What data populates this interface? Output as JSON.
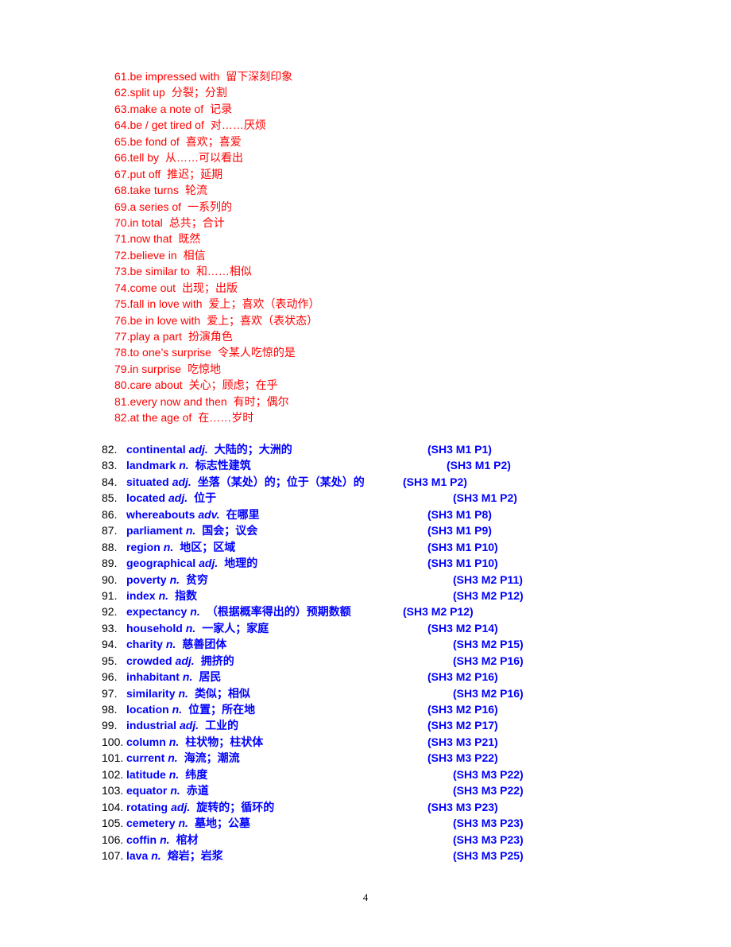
{
  "colors": {
    "phrase": "#ff0000",
    "vocab": "#0000ff",
    "number": "#000000"
  },
  "phrases": [
    {
      "n": "61.",
      "en": "be impressed with",
      "zh": "留下深刻印象"
    },
    {
      "n": "62.",
      "en": "split up",
      "zh": "分裂；分割"
    },
    {
      "n": "63.",
      "en": "make a note of",
      "zh": "记录"
    },
    {
      "n": "64.",
      "en": "be / get tired of",
      "zh": "对……厌烦"
    },
    {
      "n": "65.",
      "en": "be fond of",
      "zh": "喜欢；喜爱"
    },
    {
      "n": "66.",
      "en": "tell by",
      "zh": "从……可以看出"
    },
    {
      "n": "67.",
      "en": "put off",
      "zh": "推迟；延期"
    },
    {
      "n": "68.",
      "en": "take turns",
      "zh": "轮流"
    },
    {
      "n": "69.",
      "en": "a series of",
      "zh": "一系列的"
    },
    {
      "n": "70.",
      "en": "in total",
      "zh": "总共；合计"
    },
    {
      "n": "71.",
      "en": "now that",
      "zh": "既然"
    },
    {
      "n": "72.",
      "en": "believe in",
      "zh": "相信"
    },
    {
      "n": "73.",
      "en": "be similar to",
      "zh": "和……相似"
    },
    {
      "n": "74.",
      "en": "come out",
      "zh": "出现；出版"
    },
    {
      "n": "75.",
      "en": "fall in love with",
      "zh": "爱上；喜欢（表动作）"
    },
    {
      "n": "76.",
      "en": "be in love with",
      "zh": "爱上；喜欢（表状态）"
    },
    {
      "n": "77.",
      "en": "play a part",
      "zh": "扮演角色"
    },
    {
      "n": "78.",
      "en": "to one’s surprise",
      "zh": "令某人吃惊的是"
    },
    {
      "n": "79.",
      "en": "in surprise",
      "zh": "吃惊地"
    },
    {
      "n": "80.",
      "en": "care about",
      "zh": "关心；顾虑；在乎"
    },
    {
      "n": "81.",
      "en": "every now and then",
      "zh": "有时；偶尔"
    },
    {
      "n": "82.",
      "en": "at the age of",
      "zh": "在……岁时"
    }
  ],
  "vocab": [
    {
      "n": "82.",
      "word": "continental",
      "pos": "adj.",
      "zh": "大陆的；大洲的",
      "ref": "(SH3 M1 P1)",
      "col": "b"
    },
    {
      "n": "83.",
      "word": "landmark",
      "pos": "n.",
      "zh": "标志性建筑",
      "ref": "(SH3 M1 P2)",
      "col": "c"
    },
    {
      "n": "84.",
      "word": "situated",
      "pos": "adj.",
      "zh": "坐落（某处）的；位于（某处）的",
      "ref": "(SH3 M1 P2)",
      "col": "a"
    },
    {
      "n": "85.",
      "word": "located",
      "pos": "adj.",
      "zh": "位于",
      "ref": "(SH3 M1 P2)",
      "col": "d"
    },
    {
      "n": "86.",
      "word": "whereabouts",
      "pos": "adv.",
      "zh": "在哪里",
      "ref": "(SH3 M1 P8)",
      "col": "b"
    },
    {
      "n": "87.",
      "word": "parliament",
      "pos": "n.",
      "zh": "国会；议会",
      "ref": "(SH3 M1 P9)",
      "col": "b"
    },
    {
      "n": "88.",
      "word": "region",
      "pos": "n.",
      "zh": "地区；区域",
      "ref": "(SH3 M1 P10)",
      "col": "b"
    },
    {
      "n": "89.",
      "word": "geographical",
      "pos": "adj.",
      "zh": "地理的",
      "ref": "(SH3 M1 P10)",
      "col": "b"
    },
    {
      "n": "90.",
      "word": "poverty",
      "pos": "n.",
      "zh": "贫穷",
      "ref": "(SH3 M2 P11)",
      "col": "d"
    },
    {
      "n": "91.",
      "word": "index",
      "pos": "n.",
      "zh": "指数",
      "ref": "(SH3 M2 P12)",
      "col": "d"
    },
    {
      "n": "92.",
      "word": "expectancy",
      "pos": "n.",
      "zh": "（根据概率得出的）预期数额",
      "ref": "(SH3 M2 P12)",
      "col": "a"
    },
    {
      "n": "93.",
      "word": "household",
      "pos": "n.",
      "zh": "一家人；家庭",
      "ref": "(SH3 M2 P14)",
      "col": "b"
    },
    {
      "n": "94.",
      "word": "charity",
      "pos": "n.",
      "zh": "慈善团体",
      "ref": "(SH3 M2 P15)",
      "col": "d"
    },
    {
      "n": "95.",
      "word": "crowded",
      "pos": "adj.",
      "zh": "拥挤的",
      "ref": "(SH3 M2 P16)",
      "col": "d"
    },
    {
      "n": "96.",
      "word": "inhabitant",
      "pos": "n.",
      "zh": "居民",
      "ref": "(SH3 M2 P16)",
      "col": "b"
    },
    {
      "n": "97.",
      "word": "similarity",
      "pos": "n.",
      "zh": "类似；相似",
      "ref": "(SH3 M2 P16)",
      "col": "d"
    },
    {
      "n": "98.",
      "word": "location",
      "pos": "n.",
      "zh": "位置；所在地",
      "ref": "(SH3 M2 P16)",
      "col": "b"
    },
    {
      "n": "99.",
      "word": "industrial",
      "pos": "adj.",
      "zh": "工业的",
      "ref": "(SH3 M2 P17)",
      "col": "b"
    },
    {
      "n": "100.",
      "word": "column",
      "pos": "n.",
      "zh": "柱状物；柱状体",
      "ref": "(SH3 M3 P21)",
      "col": "b"
    },
    {
      "n": "101.",
      "word": "current",
      "pos": "n.",
      "zh": "海流；潮流",
      "ref": "(SH3 M3 P22)",
      "col": "b"
    },
    {
      "n": "102.",
      "word": "latitude",
      "pos": "n.",
      "zh": "纬度",
      "ref": "(SH3 M3 P22)",
      "col": "d"
    },
    {
      "n": "103.",
      "word": "equator",
      "pos": "n.",
      "zh": "赤道",
      "ref": "(SH3 M3 P22)",
      "col": "d"
    },
    {
      "n": "104.",
      "word": "rotating",
      "pos": "adj.",
      "zh": "旋转的；循环的",
      "ref": "(SH3 M3 P23)",
      "col": "b"
    },
    {
      "n": "105.",
      "word": "cemetery",
      "pos": "n.",
      "zh": "墓地；公墓",
      "ref": "(SH3 M3 P23)",
      "col": "d"
    },
    {
      "n": "106.",
      "word": "coffin",
      "pos": "n.",
      "zh": "棺材",
      "ref": "(SH3 M3 P23)",
      "col": "d"
    },
    {
      "n": "107.",
      "word": "lava",
      "pos": "n.",
      "zh": "熔岩；岩浆",
      "ref": "(SH3 M3 P25)",
      "col": "d"
    }
  ],
  "page_number": "4"
}
